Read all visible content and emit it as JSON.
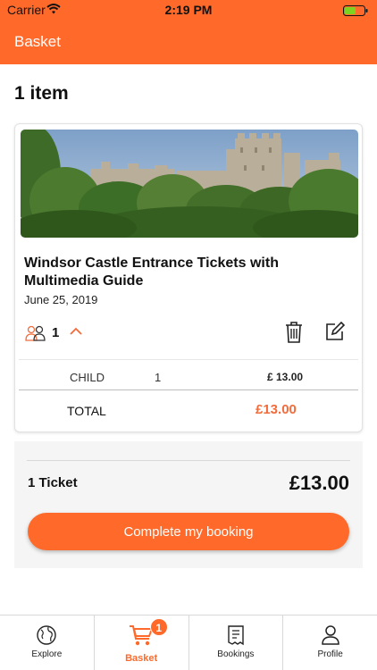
{
  "status_bar": {
    "carrier": "Carrier",
    "time": "2:19 PM",
    "battery_color": "#7ed321"
  },
  "nav": {
    "title": "Basket"
  },
  "basket": {
    "item_count": "1 item",
    "item": {
      "image": "windsor-castle-photo",
      "title": "Windsor Castle Entrance Tickets with Multimedia Guide",
      "date": "June 25, 2019",
      "people_count": "1",
      "lines": [
        {
          "type": "CHILD",
          "qty": "1",
          "price": "£ 13.00"
        }
      ],
      "total_label": "TOTAL",
      "total_price": "£13.00"
    }
  },
  "summary": {
    "ticket_count": "1 Ticket",
    "total": "£13.00",
    "button_label": "Complete my booking"
  },
  "tabs": [
    {
      "label": "Explore",
      "icon": "globe-icon"
    },
    {
      "label": "Basket",
      "icon": "cart-icon",
      "badge": "1",
      "active": true
    },
    {
      "label": "Bookings",
      "icon": "receipt-icon"
    },
    {
      "label": "Profile",
      "icon": "person-icon"
    }
  ],
  "colors": {
    "accent": "#ff6a2b",
    "price": "#f26b3a"
  }
}
